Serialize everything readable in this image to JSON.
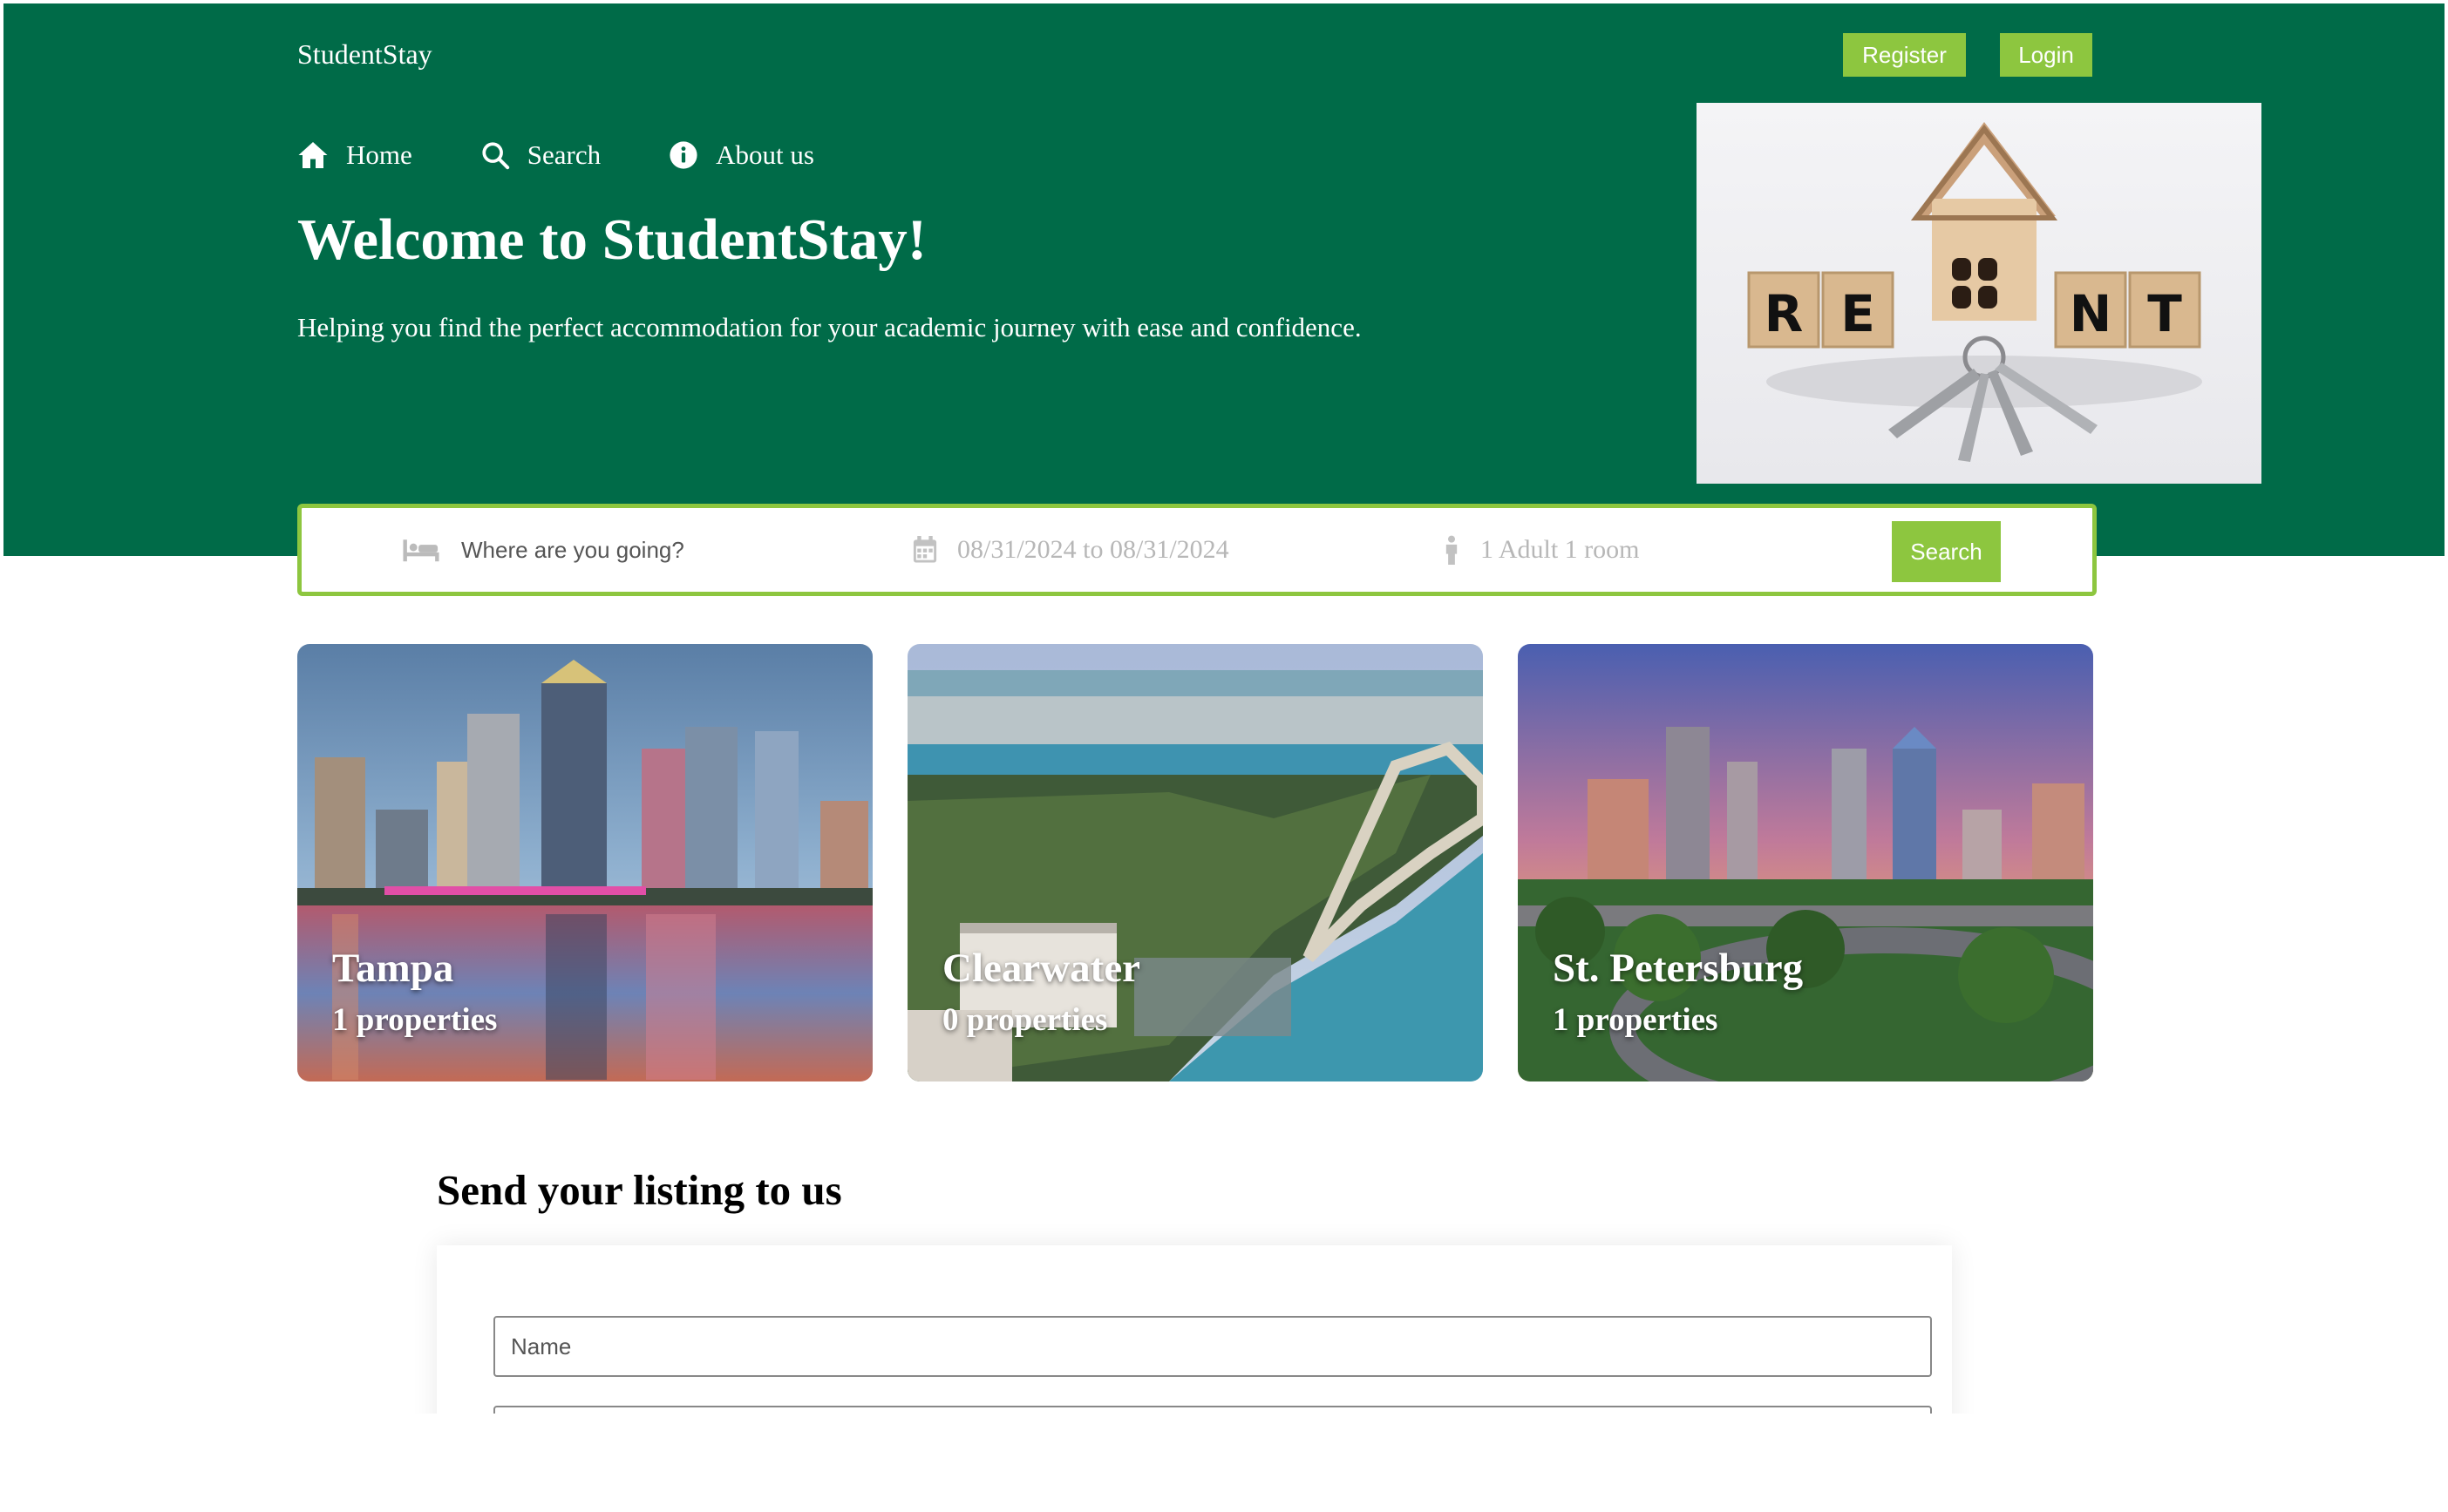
{
  "brand": "StudentStay",
  "header_buttons": {
    "register": "Register",
    "login": "Login"
  },
  "nav": [
    {
      "label": "Home",
      "icon": "home-icon"
    },
    {
      "label": "Search",
      "icon": "search-icon"
    },
    {
      "label": "About us",
      "icon": "info-icon"
    }
  ],
  "hero": {
    "title": "Welcome to StudentStay!",
    "subtitle": "Helping you find the perfect accommodation for your academic journey with ease and confidence.",
    "image_letters": [
      "R",
      "E",
      "N",
      "T"
    ]
  },
  "search": {
    "destination_placeholder": "Where are you going?",
    "dates": "08/31/2024 to 08/31/2024",
    "guests": "1 Adult 1 room",
    "button": "Search"
  },
  "cities": [
    {
      "name": "Tampa",
      "count": "1 properties"
    },
    {
      "name": "Clearwater",
      "count": "0 properties"
    },
    {
      "name": "St. Petersburg",
      "count": "1 properties"
    }
  ],
  "listing": {
    "title": "Send your listing to us",
    "name_placeholder": "Name"
  },
  "colors": {
    "primary": "#006b48",
    "accent": "#8dc63f"
  }
}
